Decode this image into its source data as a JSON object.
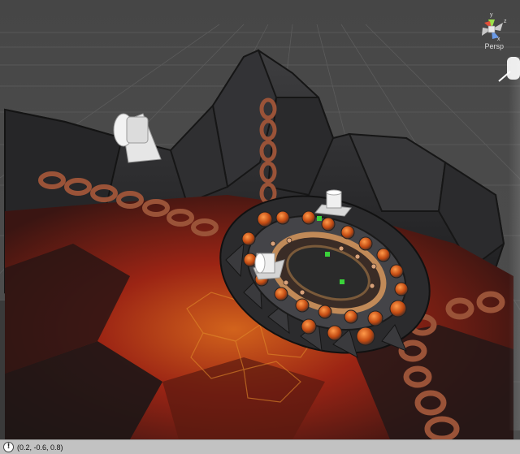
{
  "scene_view": {
    "camera_mode_label": "Persp",
    "gizmo_axes": {
      "y": "y",
      "z": "z",
      "x": "x"
    },
    "colors": {
      "grid": "#5a5a5a",
      "rock": "#2c2c2e",
      "lava": "#8c1e12",
      "lava_glow": "#c8501a",
      "chain": "#8a4a32",
      "ring": "#b07a4a",
      "light_gizmo": "#e6e6e6",
      "gem": "#d45a1a",
      "green_marker": "#3ad13a"
    }
  },
  "status_bar": {
    "icon": "info-icon",
    "icon_glyph": "!",
    "message": "(0.2, -0.6, 0.8)"
  }
}
